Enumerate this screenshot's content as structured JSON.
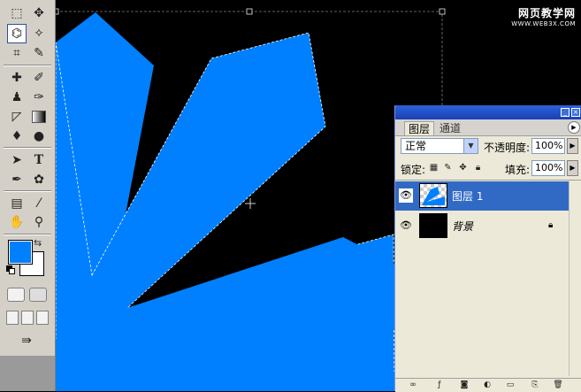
{
  "colors": {
    "canvas_bg": "#000000",
    "shape_fill": "#0080ff",
    "toolbox_bg": "#d4d0c8",
    "foreground_color": "#0080ff",
    "background_color": "#ffffff",
    "selected_layer": "#316ac5"
  },
  "watermark": {
    "title": "网页教学网",
    "url": "WWW.WEB3X.COM"
  },
  "toolbox": {
    "tools": [
      {
        "name": "rect-marquee-icon",
        "glyph": "⬚",
        "selected": false
      },
      {
        "name": "move-icon",
        "glyph": "➹",
        "selected": false
      },
      {
        "name": "polygon-lasso-icon",
        "glyph": "⌬",
        "selected": true
      },
      {
        "name": "magic-wand-icon",
        "glyph": "✧",
        "selected": false
      },
      {
        "name": "crop-icon",
        "glyph": "⌗",
        "selected": false
      },
      {
        "name": "slice-icon",
        "glyph": "✎",
        "selected": false
      },
      {
        "name": "healing-brush-icon",
        "glyph": "✚",
        "selected": false
      },
      {
        "name": "brush-icon",
        "glyph": "✐",
        "selected": false
      },
      {
        "name": "clone-stamp-icon",
        "glyph": "♟",
        "selected": false
      },
      {
        "name": "history-brush-icon",
        "glyph": "✑",
        "selected": false
      },
      {
        "name": "eraser-icon",
        "glyph": "◸",
        "selected": false
      },
      {
        "name": "gradient-icon",
        "glyph": "▬",
        "selected": false
      },
      {
        "name": "blur-icon",
        "glyph": "💧",
        "selected": false
      },
      {
        "name": "dodge-icon",
        "glyph": "●",
        "selected": false
      },
      {
        "name": "path-select-icon",
        "glyph": "➤",
        "selected": false
      },
      {
        "name": "type-icon",
        "glyph": "T",
        "selected": false
      },
      {
        "name": "pen-icon",
        "glyph": "✒",
        "selected": false
      },
      {
        "name": "custom-shape-icon",
        "glyph": "✿",
        "selected": false
      },
      {
        "name": "notes-icon",
        "glyph": "▤",
        "selected": false
      },
      {
        "name": "eyedropper-icon",
        "glyph": "⁄",
        "selected": false
      },
      {
        "name": "hand-icon",
        "glyph": "✋",
        "selected": false
      },
      {
        "name": "zoom-icon",
        "glyph": "🔍",
        "selected": false
      }
    ]
  },
  "layers_panel": {
    "tabs": [
      "图层",
      "通道"
    ],
    "blend_mode": "正常",
    "opacity_label": "不透明度:",
    "opacity_value": "100%",
    "lock_label": "锁定:",
    "fill_label": "填充:",
    "fill_value": "100%",
    "layers": [
      {
        "name": "图层 1",
        "selected": true,
        "thumb": "shape",
        "locked": false
      },
      {
        "name": "背景",
        "selected": false,
        "thumb": "black",
        "locked": true
      }
    ]
  }
}
